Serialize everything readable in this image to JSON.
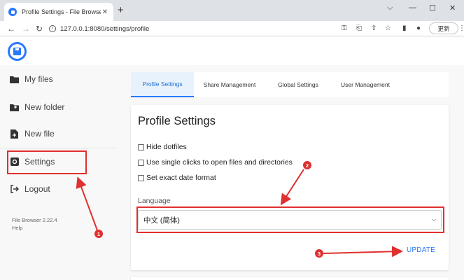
{
  "browser": {
    "tab_title": "Profile Settings - File Browser",
    "tab_close": "✕",
    "new_tab": "+",
    "window_controls": [
      "⌵",
      "—",
      "☐",
      "✕"
    ],
    "url": "127.0.0.1:8080/settings/profile",
    "update_button": "更新",
    "toolbar_icons": [
      "key-icon",
      "translate-icon",
      "share-icon",
      "star-icon",
      "sidebar-icon",
      "profile-icon",
      "menu-icon"
    ]
  },
  "sidebar": {
    "items": [
      {
        "label": "My files",
        "icon": "folder-icon"
      },
      {
        "label": "New folder",
        "icon": "folder-plus-icon"
      },
      {
        "label": "New file",
        "icon": "file-plus-icon"
      },
      {
        "label": "Settings",
        "icon": "gear-icon"
      },
      {
        "label": "Logout",
        "icon": "logout-icon"
      }
    ],
    "version": "File Browser 2.22.4",
    "help": "Help"
  },
  "tabs": [
    "Profile Settings",
    "Share Management",
    "Global Settings",
    "User Management"
  ],
  "profile": {
    "title": "Profile Settings",
    "checkboxes": [
      "Hide dotfiles",
      "Use single clicks to open files and directories",
      "Set exact date format"
    ],
    "language_label": "Language",
    "language_value": "中文 (简体)",
    "update_label": "UPDATE"
  },
  "annotations": [
    "1",
    "2",
    "3"
  ],
  "colors": {
    "accent": "#2979ff",
    "annotation": "#e0302f"
  }
}
